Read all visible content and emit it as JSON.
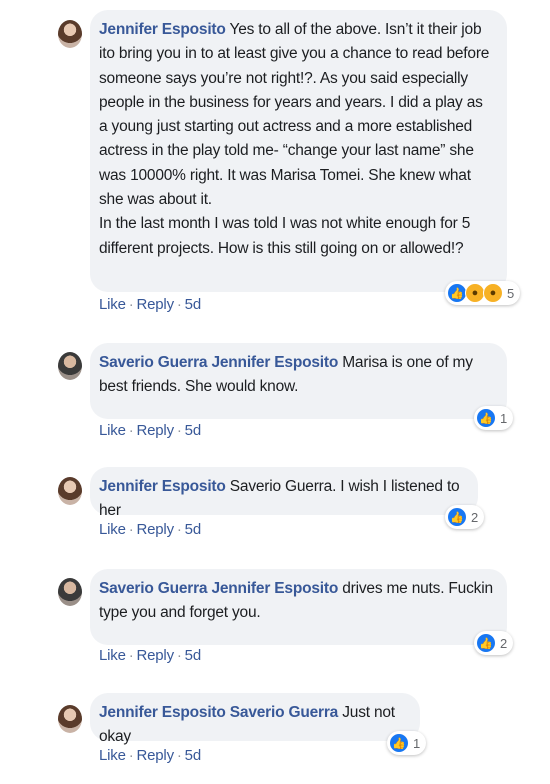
{
  "comments": [
    {
      "author": "Jennifer Esposito",
      "tag": "",
      "text": "Yes to all of the above. Isn’t it their job ito bring you in to at least give you a chance to read before someone says you’re not right!?. As you said especially people in the business for years and years. I did a play as a young just starting out actress and a more established actress in the play told me- “change your last name” she was 10000% right. It was Marisa Tomei. She knew what she was about it.\nIn the last month I was told I was not white enough for 5 different projects. How is this still going on or allowed!?",
      "like": "Like",
      "reply": "Reply",
      "time": "5d",
      "reaction_count": "5",
      "reaction_icons": [
        "like-icon",
        "wow-icon",
        "sad-icon"
      ]
    },
    {
      "author": "Saverio Guerra",
      "tag": "Jennifer Esposito",
      "text": "Marisa is one of my best friends. She would know.",
      "like": "Like",
      "reply": "Reply",
      "time": "5d",
      "reaction_count": "1",
      "reaction_icons": [
        "like-icon"
      ]
    },
    {
      "author": "Jennifer Esposito",
      "tag": "",
      "text": "Saverio Guerra. I wish I listened to her",
      "like": "Like",
      "reply": "Reply",
      "time": "5d",
      "reaction_count": "2",
      "reaction_icons": [
        "like-icon"
      ]
    },
    {
      "author": "Saverio Guerra",
      "tag": "Jennifer Esposito",
      "text": "drives me nuts. Fuckin type you and forget you.",
      "like": "Like",
      "reply": "Reply",
      "time": "5d",
      "reaction_count": "2",
      "reaction_icons": [
        "like-icon"
      ]
    },
    {
      "author": "Jennifer Esposito",
      "tag": "Saverio Guerra",
      "text": "Just not okay",
      "like": "Like",
      "reply": "Reply",
      "time": "5d",
      "reaction_count": "1",
      "reaction_icons": [
        "like-icon"
      ]
    }
  ],
  "separator": "·"
}
